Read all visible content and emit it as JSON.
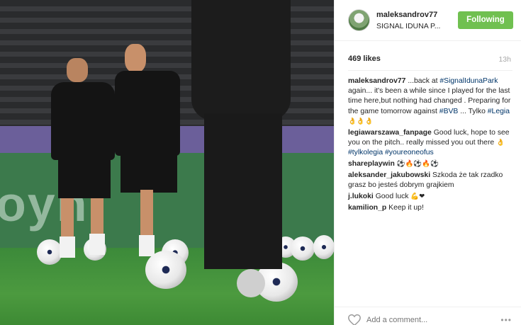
{
  "post": {
    "username": "maleksandrov77",
    "location": "SIGNAL IDUNA P...",
    "follow_label": "Following",
    "likes": "469 likes",
    "time_ago": "13h",
    "photo_board_text": "oyn"
  },
  "caption": {
    "user": "maleksandrov77",
    "text_before": " ...back at ",
    "tag1": "#SignalIdunaPark",
    "text_middle": " again... it's been a while since I played for the last time here,but nothing had changed . Preparing for the game tomorrow against ",
    "tag2": "#BVB",
    "text_after": " ... Tylko ",
    "tag3": "#Legia",
    "emoji": "👌👌👌"
  },
  "comments": [
    {
      "user": "legiawarszawa_fanpage",
      "text": " Good luck, hope to see you on the pitch.. really missed you out there ",
      "emoji": "👌 ",
      "tag1": "#tylkolegia",
      "sep": " ",
      "tag2": "#youreoneofus"
    },
    {
      "user": "shareplaywin",
      "text": " ",
      "emoji": "⚽🔥⚽🔥⚽"
    },
    {
      "user": "aleksander_jakubowski",
      "text": " Szkoda że tak rzadko grasz bo jesteś dobrym grajkiem"
    },
    {
      "user": "j.lukoki",
      "text": " Good luck ",
      "emoji": "💪❤"
    },
    {
      "user": "kamilion_p",
      "text": " Keep it up!"
    }
  ],
  "footer": {
    "comment_placeholder": "Add a comment...",
    "more": "•••"
  },
  "colors": {
    "follow_button": "#70c050",
    "hashtag": "#003569"
  },
  "icons": {
    "like": "heart-icon",
    "more": "more-options-icon"
  }
}
